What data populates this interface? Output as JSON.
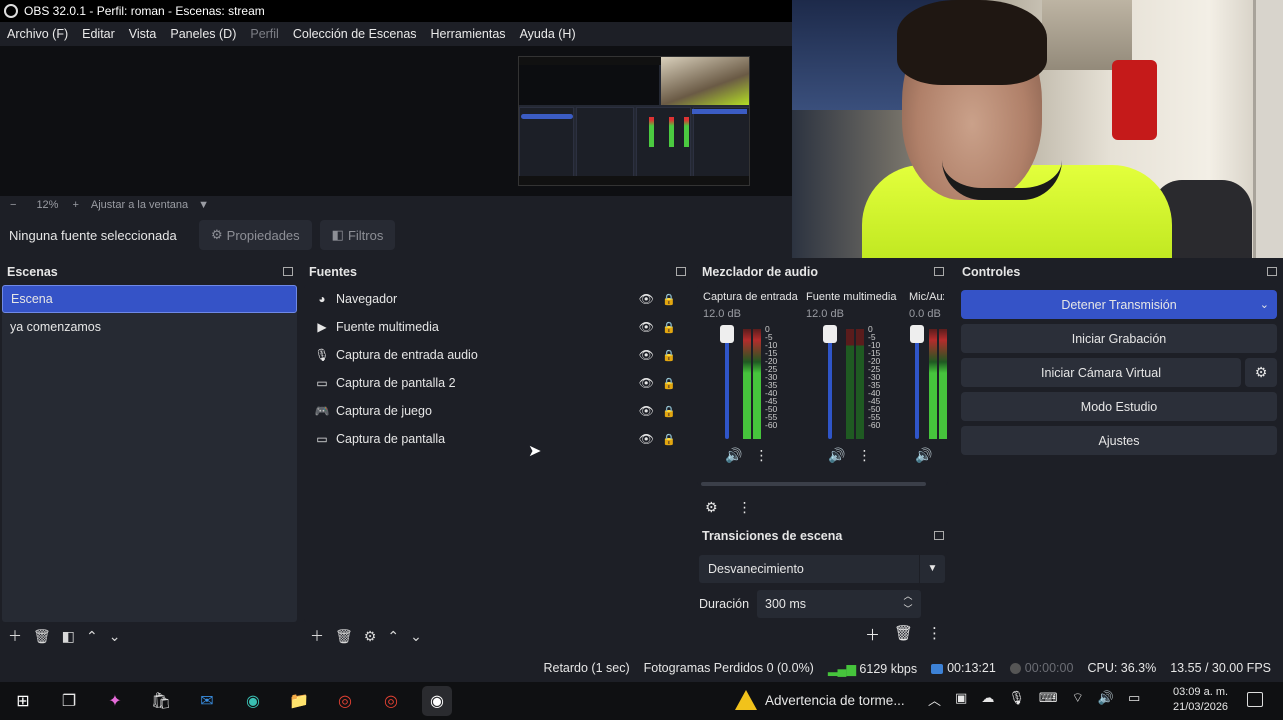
{
  "window": {
    "title": "OBS 32.0.1 - Perfil: roman - Escenas: stream"
  },
  "menu": [
    "Archivo (F)",
    "Editar",
    "Vista",
    "Paneles (D)",
    "Perfil",
    "Colección de Escenas",
    "Herramientas",
    "Ayuda (H)"
  ],
  "zoom": {
    "minus": "−",
    "value": "12%",
    "plus": "+",
    "fit": "Ajustar a la ventana"
  },
  "source_toolbar": {
    "no_source": "Ninguna fuente seleccionada",
    "properties": "Propiedades",
    "filters": "Filtros"
  },
  "scenes": {
    "title": "Escenas",
    "items": [
      "Escena",
      "ya comenzamos"
    ]
  },
  "sources": {
    "title": "Fuentes",
    "items": [
      {
        "label": "Navegador",
        "icon": "globe-icon"
      },
      {
        "label": "Fuente multimedia",
        "icon": "play-icon"
      },
      {
        "label": "Captura de entrada audio",
        "icon": "microphone-icon"
      },
      {
        "label": "Captura de pantalla 2",
        "icon": "monitor-icon"
      },
      {
        "label": "Captura de juego",
        "icon": "gamepad-icon"
      },
      {
        "label": "Captura de pantalla",
        "icon": "monitor-icon"
      }
    ]
  },
  "mixer": {
    "title": "Mezclador de audio",
    "channels": [
      {
        "name": "Captura de entrada audio",
        "db": "12.0 dB",
        "level": 0.85
      },
      {
        "name": "Fuente multimedia",
        "db": "12.0 dB",
        "level": 0.0
      },
      {
        "name": "Mic/Aux",
        "db": "0.0 dB",
        "level": 0.55
      }
    ],
    "ticks": [
      "0",
      "-5",
      "-10",
      "-15",
      "-20",
      "-25",
      "-30",
      "-35",
      "-40",
      "-45",
      "-50",
      "-55",
      "-60"
    ]
  },
  "transitions": {
    "title": "Transiciones de escena",
    "selected": "Desvanecimiento",
    "duration_label": "Duración",
    "duration": "300 ms"
  },
  "controls": {
    "title": "Controles",
    "stop_stream": "Detener Transmisión",
    "start_record": "Iniciar Grabación",
    "virtual_cam": "Iniciar Cámara Virtual",
    "studio_mode": "Modo Estudio",
    "settings": "Ajustes"
  },
  "status": {
    "delay": "Retardo (1 sec)",
    "dropped": "Fotogramas Perdidos 0 (0.0%)",
    "bitrate": "6129 kbps",
    "live_time": "00:13:21",
    "rec_time": "00:00:00",
    "cpu": "CPU: 36.3%",
    "fps": "13.55 / 30.00 FPS"
  },
  "taskbar": {
    "warning": "Advertencia de torme...",
    "time": "03:09 a. m.",
    "date": "21/03/2026"
  },
  "colors": {
    "accent": "#3553c7",
    "panel": "#1d1f26",
    "list": "#262a33",
    "meter_green": "#46c43c"
  }
}
